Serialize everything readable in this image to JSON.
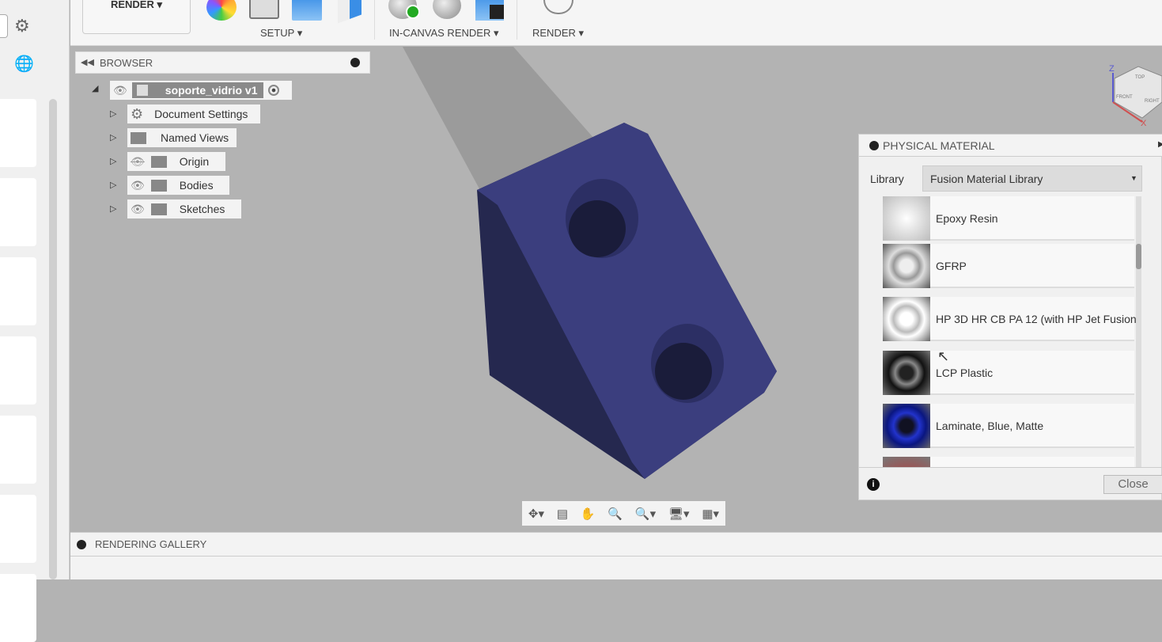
{
  "toolbar": {
    "render_menu": "RENDER ▾",
    "setup": "SETUP ▾",
    "in_canvas": "IN-CANVAS RENDER ▾",
    "render": "RENDER ▾"
  },
  "browser": {
    "title": "BROWSER",
    "root": "soporte_vidrio v1",
    "items": [
      {
        "label": "Document Settings",
        "icon": "gear-icon"
      },
      {
        "label": "Named Views",
        "icon": "folder-icon"
      },
      {
        "label": "Origin",
        "icon": "folder-icon",
        "visible": false
      },
      {
        "label": "Bodies",
        "icon": "folder-icon",
        "visible": true
      },
      {
        "label": "Sketches",
        "icon": "folder-icon",
        "visible": true
      }
    ]
  },
  "viewcube": {
    "top": "TOP",
    "front": "FRONT",
    "right": "RIGHT",
    "z": "Z",
    "x": "X"
  },
  "physical_material": {
    "title": "PHYSICAL MATERIAL",
    "library_label": "Library",
    "library_value": "Fusion Material Library",
    "materials": [
      {
        "name": "Epoxy Resin",
        "color": "#dcdcdc"
      },
      {
        "name": "GFRP",
        "color": "#c8c8c8"
      },
      {
        "name": "HP 3D HR CB PA 12 (with HP Jet Fusion",
        "color": "#e6e6e6"
      },
      {
        "name": "LCP Plastic",
        "color": "#111111"
      },
      {
        "name": "Laminate, Blue, Matte",
        "color": "#1a2aa0"
      },
      {
        "name": "",
        "color": "#d02020"
      }
    ],
    "close": "Close"
  },
  "gallery": {
    "title": "RENDERING GALLERY"
  },
  "colors": {
    "part_top": "#3b3e7e",
    "part_side": "#25284f"
  }
}
